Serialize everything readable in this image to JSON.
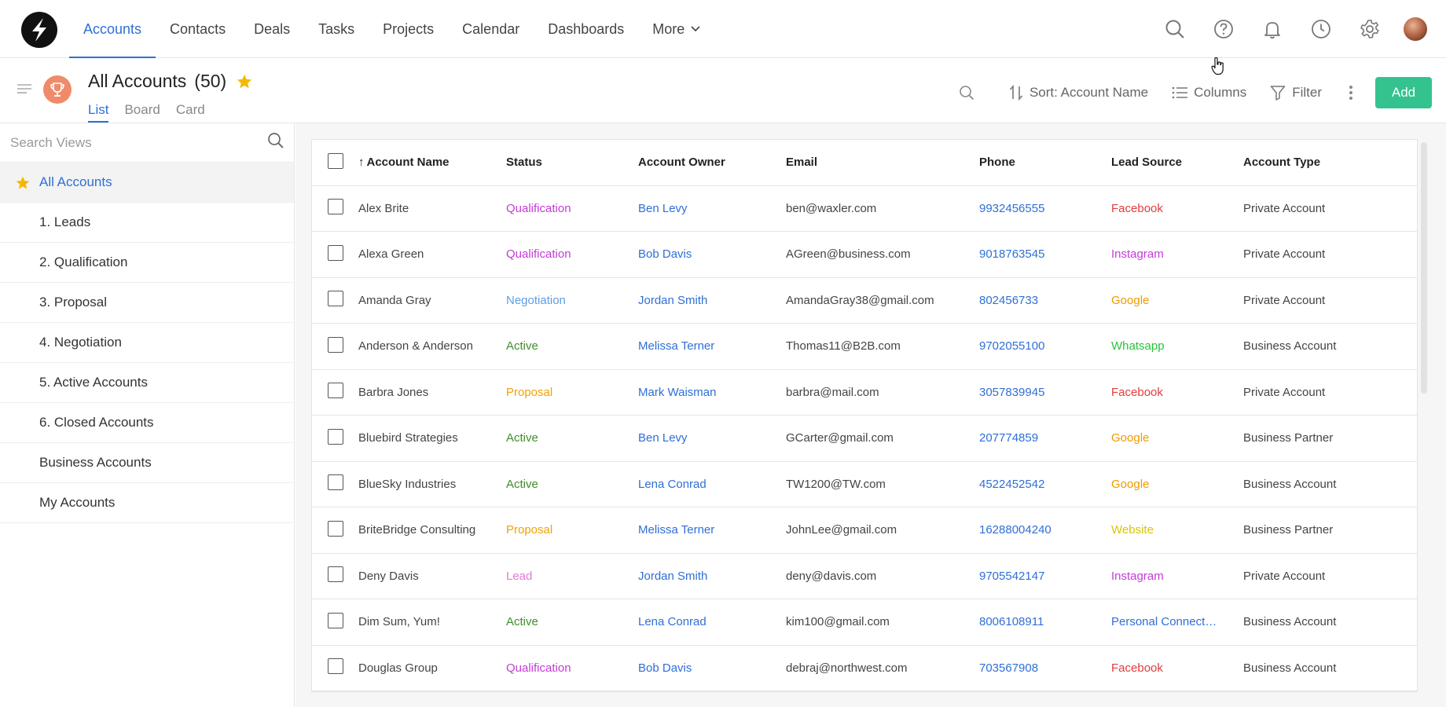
{
  "nav": {
    "items": [
      {
        "label": "Accounts",
        "active": true
      },
      {
        "label": "Contacts",
        "active": false
      },
      {
        "label": "Deals",
        "active": false
      },
      {
        "label": "Tasks",
        "active": false
      },
      {
        "label": "Projects",
        "active": false
      },
      {
        "label": "Calendar",
        "active": false
      },
      {
        "label": "Dashboards",
        "active": false
      }
    ],
    "more_label": "More"
  },
  "header": {
    "title": "All Accounts",
    "count": "(50)",
    "view_tabs": [
      "List",
      "Board",
      "Card"
    ],
    "sort_label": "Sort: Account Name",
    "columns_label": "Columns",
    "filter_label": "Filter",
    "add_label": "Add"
  },
  "sidebar": {
    "search_placeholder": "Search Views",
    "views": [
      "All Accounts",
      "1. Leads",
      "2. Qualification",
      "3. Proposal",
      "4. Negotiation",
      "5. Active Accounts",
      "6. Closed Accounts",
      "Business Accounts",
      "My Accounts"
    ]
  },
  "colors": {
    "accent": "#2f6fd6",
    "add_button": "#34c38f",
    "star": "#f5b800",
    "trophy_bg": "#ef8b6b",
    "status": {
      "Qualification": "#c53bd8",
      "Negotiation": "#5c9ee6",
      "Active": "#3f8f29",
      "Proposal": "#f0a20a",
      "Lead": "#e07ad6"
    },
    "source": {
      "Facebook": "#e23c3c",
      "Instagram": "#c53bd8",
      "Google": "#f09a00",
      "Whatsapp": "#2cc13b",
      "Website": "#d9c400",
      "Personal Connect…": "#2f6fd6"
    }
  },
  "table": {
    "columns": [
      "Account Name",
      "Status",
      "Account Owner",
      "Email",
      "Phone",
      "Lead Source",
      "Account Type"
    ],
    "rows": [
      {
        "name": "Alex Brite",
        "status": "Qualification",
        "owner": "Ben Levy",
        "email": "ben@waxler.com",
        "phone": "9932456555",
        "source": "Facebook",
        "type": "Private Account"
      },
      {
        "name": "Alexa Green",
        "status": "Qualification",
        "owner": "Bob Davis",
        "email": "AGreen@business.com",
        "phone": "9018763545",
        "source": "Instagram",
        "type": "Private Account"
      },
      {
        "name": "Amanda Gray",
        "status": "Negotiation",
        "owner": "Jordan Smith",
        "email": "AmandaGray38@gmail.com",
        "phone": "802456733",
        "source": "Google",
        "type": "Private Account"
      },
      {
        "name": "Anderson & Anderson",
        "status": "Active",
        "owner": "Melissa Terner",
        "email": "Thomas11@B2B.com",
        "phone": "9702055100",
        "source": "Whatsapp",
        "type": "Business Account"
      },
      {
        "name": "Barbra Jones",
        "status": "Proposal",
        "owner": "Mark Waisman",
        "email": "barbra@mail.com",
        "phone": "3057839945",
        "source": "Facebook",
        "type": "Private Account"
      },
      {
        "name": "Bluebird Strategies",
        "status": "Active",
        "owner": "Ben Levy",
        "email": "GCarter@gmail.com",
        "phone": "207774859",
        "source": "Google",
        "type": "Business Partner"
      },
      {
        "name": "BlueSky Industries",
        "status": "Active",
        "owner": "Lena Conrad",
        "email": "TW1200@TW.com",
        "phone": "4522452542",
        "source": "Google",
        "type": "Business Account"
      },
      {
        "name": "BriteBridge Consulting",
        "status": "Proposal",
        "owner": "Melissa Terner",
        "email": "JohnLee@gmail.com",
        "phone": "16288004240",
        "source": "Website",
        "type": "Business Partner"
      },
      {
        "name": "Deny Davis",
        "status": "Lead",
        "owner": "Jordan Smith",
        "email": "deny@davis.com",
        "phone": "9705542147",
        "source": "Instagram",
        "type": "Private Account"
      },
      {
        "name": "Dim Sum, Yum!",
        "status": "Active",
        "owner": "Lena Conrad",
        "email": "kim100@gmail.com",
        "phone": "8006108911",
        "source": "Personal Connect…",
        "type": "Business Account"
      },
      {
        "name": "Douglas Group",
        "status": "Qualification",
        "owner": "Bob Davis",
        "email": "debraj@northwest.com",
        "phone": "703567908",
        "source": "Facebook",
        "type": "Business Account"
      }
    ]
  }
}
